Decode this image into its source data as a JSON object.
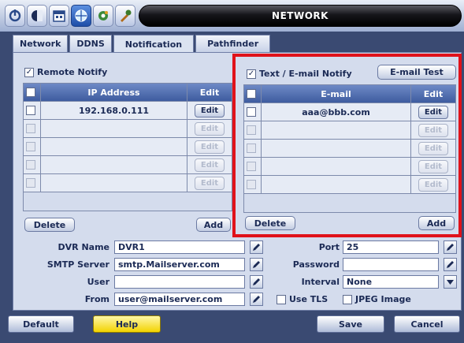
{
  "window": {
    "title": "NETWORK"
  },
  "toolbar": {
    "icons": [
      "power-icon",
      "display-icon",
      "calendar-icon",
      "network-icon",
      "settings-icon",
      "tools-icon"
    ]
  },
  "tabs": [
    "Network",
    "DDNS",
    "Notification",
    "Pathfinder"
  ],
  "remote_notify": {
    "label": "Remote Notify",
    "checked": true,
    "columns": {
      "ip": "IP Address",
      "edit": "Edit"
    },
    "rows": [
      {
        "ip": "192.168.0.111",
        "edit": "Edit",
        "enabled": true
      },
      {
        "ip": "",
        "edit": "Edit",
        "enabled": false
      },
      {
        "ip": "",
        "edit": "Edit",
        "enabled": false
      },
      {
        "ip": "",
        "edit": "Edit",
        "enabled": false
      },
      {
        "ip": "",
        "edit": "Edit",
        "enabled": false
      }
    ],
    "delete_label": "Delete",
    "add_label": "Add"
  },
  "email_notify": {
    "label": "Text / E-mail Notify",
    "checked": true,
    "test_label": "E-mail Test",
    "columns": {
      "email": "E-mail",
      "edit": "Edit"
    },
    "rows": [
      {
        "email": "aaa@bbb.com",
        "edit": "Edit",
        "enabled": true
      },
      {
        "email": "",
        "edit": "Edit",
        "enabled": false
      },
      {
        "email": "",
        "edit": "Edit",
        "enabled": false
      },
      {
        "email": "",
        "edit": "Edit",
        "enabled": false
      },
      {
        "email": "",
        "edit": "Edit",
        "enabled": false
      }
    ],
    "delete_label": "Delete",
    "add_label": "Add"
  },
  "smtp": {
    "dvr_name_label": "DVR Name",
    "dvr_name": "DVR1",
    "server_label": "SMTP Server",
    "server": "smtp.Mailserver.com",
    "user_label": "User",
    "user": "",
    "from_label": "From",
    "from": "user@mailserver.com",
    "port_label": "Port",
    "port": "25",
    "password_label": "Password",
    "password": "",
    "interval_label": "Interval",
    "interval": "None",
    "use_tls_label": "Use TLS",
    "jpeg_label": "JPEG Image"
  },
  "footer": {
    "default_label": "Default",
    "help_label": "Help",
    "save_label": "Save",
    "cancel_label": "Cancel"
  },
  "colors": {
    "highlight": "#e0121a",
    "help_button": "#f2d300",
    "header": "#3e5c9f"
  }
}
